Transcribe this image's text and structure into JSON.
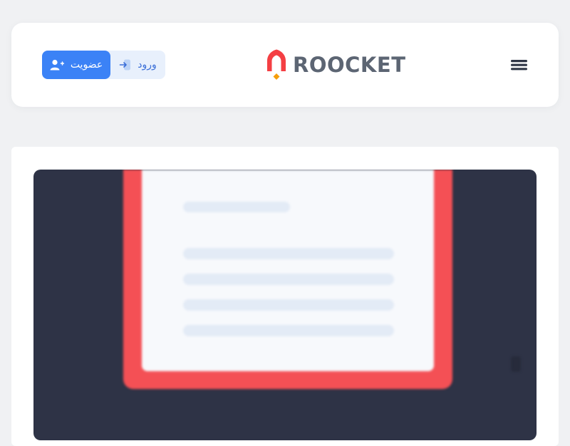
{
  "header": {
    "brand": "ROOCKET",
    "signup_label": "عضویت",
    "login_label": "ورود"
  },
  "icons": {
    "signup": "user-plus-icon",
    "login": "login-arrow-icon",
    "logo": "rocket-logo-icon",
    "menu": "hamburger-menu-icon"
  },
  "colors": {
    "primary": "#3b82f6",
    "brand_red": "#f43f43",
    "brand_orange": "#f59e0b",
    "hero_bg": "#2e3346",
    "page_bg": "#f0f1f3"
  }
}
